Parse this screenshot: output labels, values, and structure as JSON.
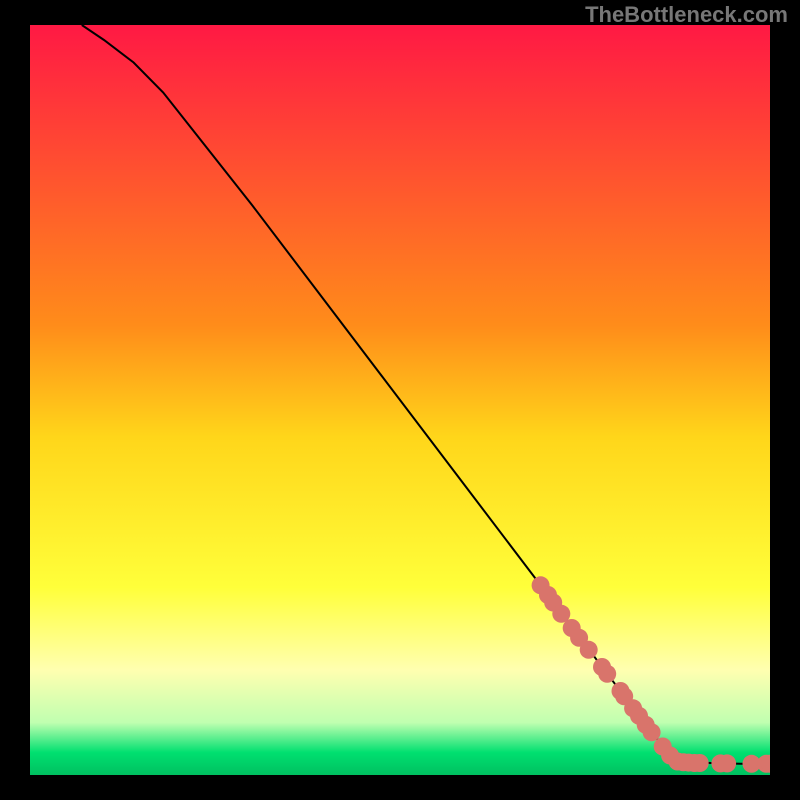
{
  "watermark": "TheBottleneck.com",
  "chart_data": {
    "type": "line",
    "title": "",
    "xlabel": "",
    "ylabel": "",
    "xlim": [
      0,
      100
    ],
    "ylim": [
      0,
      100
    ],
    "gradient_stops": [
      {
        "offset": 0,
        "color": "#ff1944"
      },
      {
        "offset": 40,
        "color": "#ff8c1a"
      },
      {
        "offset": 55,
        "color": "#ffd61a"
      },
      {
        "offset": 75,
        "color": "#ffff3a"
      },
      {
        "offset": 86,
        "color": "#ffffb0"
      },
      {
        "offset": 93,
        "color": "#c0ffb0"
      },
      {
        "offset": 97,
        "color": "#00e070"
      },
      {
        "offset": 100,
        "color": "#00c060"
      }
    ],
    "series": [
      {
        "name": "curve",
        "type": "line",
        "points": [
          {
            "x": 7,
            "y": 100
          },
          {
            "x": 10,
            "y": 98
          },
          {
            "x": 14,
            "y": 95
          },
          {
            "x": 18,
            "y": 91
          },
          {
            "x": 22,
            "y": 86
          },
          {
            "x": 30,
            "y": 76
          },
          {
            "x": 40,
            "y": 63
          },
          {
            "x": 50,
            "y": 50
          },
          {
            "x": 60,
            "y": 37
          },
          {
            "x": 70,
            "y": 24
          },
          {
            "x": 78,
            "y": 13.5
          },
          {
            "x": 85,
            "y": 4.5
          },
          {
            "x": 87,
            "y": 2.3
          },
          {
            "x": 88,
            "y": 1.8
          },
          {
            "x": 92,
            "y": 1.6
          },
          {
            "x": 96,
            "y": 1.5
          },
          {
            "x": 100,
            "y": 1.5
          }
        ]
      },
      {
        "name": "markers",
        "type": "scatter",
        "color": "#d9746b",
        "radius": 9,
        "points": [
          {
            "x": 69,
            "y": 25.3
          },
          {
            "x": 70,
            "y": 24.0
          },
          {
            "x": 70.7,
            "y": 23.0
          },
          {
            "x": 71.8,
            "y": 21.5
          },
          {
            "x": 73.2,
            "y": 19.6
          },
          {
            "x": 74.2,
            "y": 18.3
          },
          {
            "x": 75.5,
            "y": 16.7
          },
          {
            "x": 77.3,
            "y": 14.4
          },
          {
            "x": 78,
            "y": 13.5
          },
          {
            "x": 79.8,
            "y": 11.2
          },
          {
            "x": 80.3,
            "y": 10.5
          },
          {
            "x": 81.5,
            "y": 8.9
          },
          {
            "x": 82.3,
            "y": 7.9
          },
          {
            "x": 83.2,
            "y": 6.7
          },
          {
            "x": 84,
            "y": 5.7
          },
          {
            "x": 85.5,
            "y": 3.8
          },
          {
            "x": 86.5,
            "y": 2.6
          },
          {
            "x": 87.5,
            "y": 1.8
          },
          {
            "x": 88.3,
            "y": 1.7
          },
          {
            "x": 89,
            "y": 1.65
          },
          {
            "x": 89.8,
            "y": 1.6
          },
          {
            "x": 90.5,
            "y": 1.6
          },
          {
            "x": 93.3,
            "y": 1.55
          },
          {
            "x": 94.2,
            "y": 1.55
          },
          {
            "x": 97.5,
            "y": 1.5
          },
          {
            "x": 99.5,
            "y": 1.5
          },
          {
            "x": 100,
            "y": 1.5
          }
        ]
      }
    ]
  }
}
